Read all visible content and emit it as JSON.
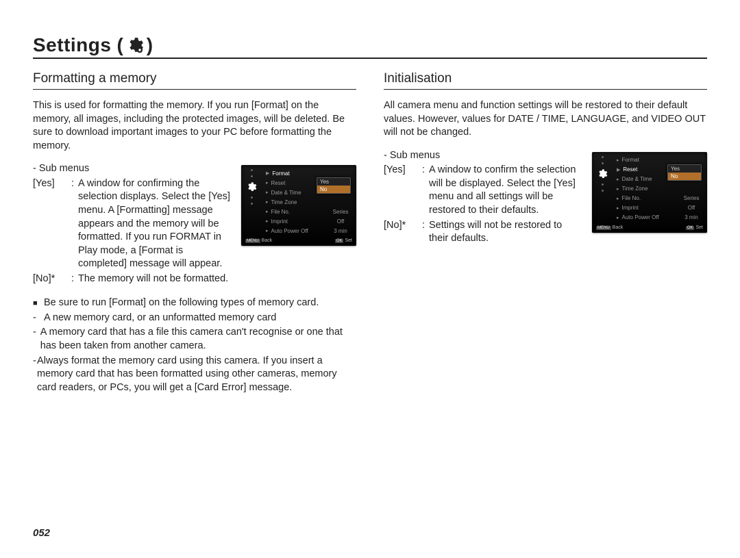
{
  "page_title": "Settings",
  "page_number": "052",
  "left": {
    "heading": "Formatting a memory",
    "intro": "This is used for formatting the memory. If you run [Format] on the memory, all images, including the protected images, will be deleted. Be sure to download important images to your PC before formatting the memory.",
    "sub_title": "- Sub menus",
    "options": [
      {
        "key": "[Yes]",
        "text": "A window for confirming the selection displays. Select the [Yes] menu. A [Formatting] message appears and the memory will be formatted. If you run FORMAT in Play mode, a [Format is completed] message will appear."
      },
      {
        "key": "[No]*",
        "text": "The memory will not be formatted."
      }
    ],
    "note_lead": "Be sure to run [Format] on the following types of memory card.",
    "notes": [
      "A new memory card, or an unformatted memory card",
      "A memory card that has a file this camera can't recognise or one that has been taken from another camera.",
      "Always format the memory card using this camera. If you insert a memory card that has been formatted using other cameras, memory card readers, or PCs, you will get a [Card Error] message."
    ]
  },
  "right": {
    "heading": "Initialisation",
    "intro": "All camera menu and function settings will be restored to their default values. However, values for DATE / TIME, LANGUAGE, and VIDEO OUT will not be changed.",
    "sub_title": "- Sub menus",
    "options": [
      {
        "key": "[Yes]",
        "text": "A window to confirm the selection will be displayed. Select the [Yes] menu and all settings will be restored to their defaults."
      },
      {
        "key": "[No]*",
        "text": "Settings will not be restored to their defaults."
      }
    ]
  },
  "lcd_left": {
    "highlight_index": 0,
    "items": [
      {
        "label": "Format",
        "value": ""
      },
      {
        "label": "Reset",
        "value": ""
      },
      {
        "label": "Date & Time",
        "value": ""
      },
      {
        "label": "Time Zone",
        "value": ""
      },
      {
        "label": "File No.",
        "value": "Series"
      },
      {
        "label": "Imprint",
        "value": "Off"
      },
      {
        "label": "Auto Power Off",
        "value": "3 min"
      }
    ],
    "popup": [
      "Yes",
      "No"
    ],
    "popup_selected": 1,
    "footer_back_btn": "MENU",
    "footer_back": "Back",
    "footer_set_btn": "OK",
    "footer_set": "Set"
  },
  "lcd_right": {
    "highlight_index": 1,
    "items": [
      {
        "label": "Format",
        "value": ""
      },
      {
        "label": "Reset",
        "value": ""
      },
      {
        "label": "Date & Time",
        "value": ""
      },
      {
        "label": "Time Zone",
        "value": ""
      },
      {
        "label": "File No.",
        "value": "Series"
      },
      {
        "label": "Imprint",
        "value": "Off"
      },
      {
        "label": "Auto Power Off",
        "value": "3 min"
      }
    ],
    "popup": [
      "Yes",
      "No"
    ],
    "popup_selected": 1,
    "footer_back_btn": "MENU",
    "footer_back": "Back",
    "footer_set_btn": "OK",
    "footer_set": "Set"
  }
}
